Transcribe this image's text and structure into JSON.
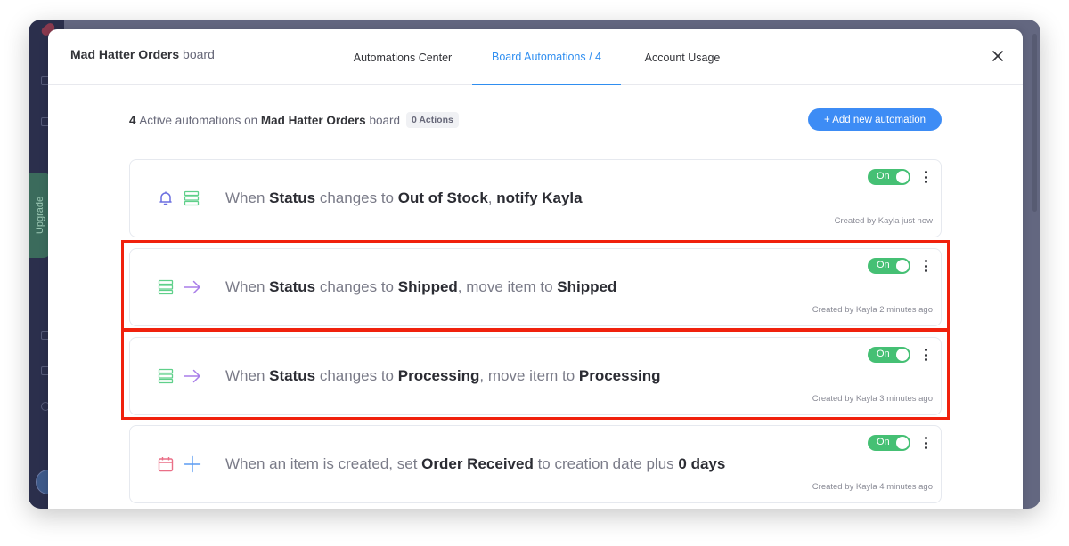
{
  "background_app": {
    "sidebar": {
      "upgrade_label": "Upgrade"
    }
  },
  "modal": {
    "board_title": {
      "name": "Mad Hatter Orders",
      "suffix": "board"
    },
    "tabs": [
      {
        "label": "Automations Center",
        "active": false
      },
      {
        "label": "Board Automations / 4",
        "active": true
      },
      {
        "label": "Account Usage",
        "active": false
      }
    ],
    "close_icon": "close-icon",
    "summary": {
      "count": "4",
      "text_mid": "Active automations on",
      "board_name": "Mad Hatter Orders",
      "text_end": "board",
      "actions_badge": "0 Actions"
    },
    "add_button_label": "+ Add new automation",
    "automations": [
      {
        "icons": [
          "bell-icon",
          "board-icon"
        ],
        "parts": [
          {
            "t": "When ",
            "b": false
          },
          {
            "t": "Status",
            "b": true
          },
          {
            "t": " changes to ",
            "b": false
          },
          {
            "t": "Out of Stock",
            "b": true
          },
          {
            "t": ", ",
            "b": false
          },
          {
            "t": "notify Kayla",
            "b": true
          }
        ],
        "toggle_label": "On",
        "enabled": true,
        "created": "Created by Kayla just now",
        "highlighted": false
      },
      {
        "icons": [
          "board-icon",
          "arrow-right-icon"
        ],
        "parts": [
          {
            "t": "When ",
            "b": false
          },
          {
            "t": "Status",
            "b": true
          },
          {
            "t": " changes to ",
            "b": false
          },
          {
            "t": "Shipped",
            "b": true
          },
          {
            "t": ", move item to ",
            "b": false
          },
          {
            "t": "Shipped",
            "b": true
          }
        ],
        "toggle_label": "On",
        "enabled": true,
        "created": "Created by Kayla 2 minutes ago",
        "highlighted": true
      },
      {
        "icons": [
          "board-icon",
          "arrow-right-icon"
        ],
        "parts": [
          {
            "t": "When ",
            "b": false
          },
          {
            "t": "Status",
            "b": true
          },
          {
            "t": " changes to ",
            "b": false
          },
          {
            "t": "Processing",
            "b": true
          },
          {
            "t": ", move item to ",
            "b": false
          },
          {
            "t": "Processing",
            "b": true
          }
        ],
        "toggle_label": "On",
        "enabled": true,
        "created": "Created by Kayla 3 minutes ago",
        "highlighted": true
      },
      {
        "icons": [
          "calendar-icon",
          "plus-icon"
        ],
        "parts": [
          {
            "t": "When an item is created, set ",
            "b": false
          },
          {
            "t": "Order Received",
            "b": true
          },
          {
            "t": " to creation date plus ",
            "b": false
          },
          {
            "t": "0 days",
            "b": true
          }
        ],
        "toggle_label": "On",
        "enabled": true,
        "created": "Created by Kayla 4 minutes ago",
        "highlighted": false
      }
    ]
  },
  "colors": {
    "accent_blue": "#2f8ef0",
    "button_blue": "#3d8cf5",
    "toggle_green": "#45c074",
    "highlight_red": "#f0210d",
    "bell_purple": "#6b6fe0",
    "board_green": "#5fd08a",
    "arrow_purple": "#a87de8",
    "calendar_pink": "#ea6f87",
    "plus_blue": "#5b9cf2"
  }
}
